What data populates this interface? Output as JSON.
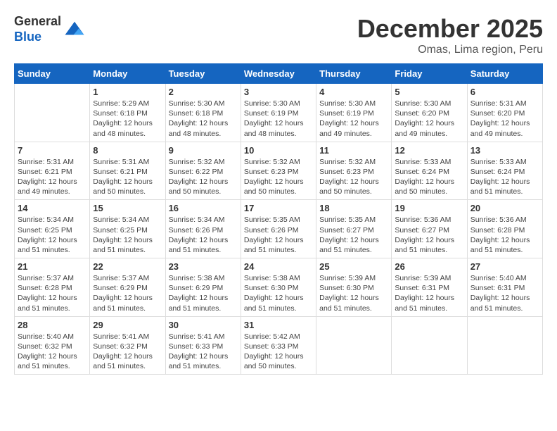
{
  "logo": {
    "line1": "General",
    "line2": "Blue"
  },
  "title": "December 2025",
  "subtitle": "Omas, Lima region, Peru",
  "weekdays": [
    "Sunday",
    "Monday",
    "Tuesday",
    "Wednesday",
    "Thursday",
    "Friday",
    "Saturday"
  ],
  "weeks": [
    [
      {
        "date": "",
        "info": ""
      },
      {
        "date": "1",
        "info": "Sunrise: 5:29 AM\nSunset: 6:18 PM\nDaylight: 12 hours\nand 48 minutes."
      },
      {
        "date": "2",
        "info": "Sunrise: 5:30 AM\nSunset: 6:18 PM\nDaylight: 12 hours\nand 48 minutes."
      },
      {
        "date": "3",
        "info": "Sunrise: 5:30 AM\nSunset: 6:19 PM\nDaylight: 12 hours\nand 48 minutes."
      },
      {
        "date": "4",
        "info": "Sunrise: 5:30 AM\nSunset: 6:19 PM\nDaylight: 12 hours\nand 49 minutes."
      },
      {
        "date": "5",
        "info": "Sunrise: 5:30 AM\nSunset: 6:20 PM\nDaylight: 12 hours\nand 49 minutes."
      },
      {
        "date": "6",
        "info": "Sunrise: 5:31 AM\nSunset: 6:20 PM\nDaylight: 12 hours\nand 49 minutes."
      }
    ],
    [
      {
        "date": "7",
        "info": "Sunrise: 5:31 AM\nSunset: 6:21 PM\nDaylight: 12 hours\nand 49 minutes."
      },
      {
        "date": "8",
        "info": "Sunrise: 5:31 AM\nSunset: 6:21 PM\nDaylight: 12 hours\nand 50 minutes."
      },
      {
        "date": "9",
        "info": "Sunrise: 5:32 AM\nSunset: 6:22 PM\nDaylight: 12 hours\nand 50 minutes."
      },
      {
        "date": "10",
        "info": "Sunrise: 5:32 AM\nSunset: 6:23 PM\nDaylight: 12 hours\nand 50 minutes."
      },
      {
        "date": "11",
        "info": "Sunrise: 5:32 AM\nSunset: 6:23 PM\nDaylight: 12 hours\nand 50 minutes."
      },
      {
        "date": "12",
        "info": "Sunrise: 5:33 AM\nSunset: 6:24 PM\nDaylight: 12 hours\nand 50 minutes."
      },
      {
        "date": "13",
        "info": "Sunrise: 5:33 AM\nSunset: 6:24 PM\nDaylight: 12 hours\nand 51 minutes."
      }
    ],
    [
      {
        "date": "14",
        "info": "Sunrise: 5:34 AM\nSunset: 6:25 PM\nDaylight: 12 hours\nand 51 minutes."
      },
      {
        "date": "15",
        "info": "Sunrise: 5:34 AM\nSunset: 6:25 PM\nDaylight: 12 hours\nand 51 minutes."
      },
      {
        "date": "16",
        "info": "Sunrise: 5:34 AM\nSunset: 6:26 PM\nDaylight: 12 hours\nand 51 minutes."
      },
      {
        "date": "17",
        "info": "Sunrise: 5:35 AM\nSunset: 6:26 PM\nDaylight: 12 hours\nand 51 minutes."
      },
      {
        "date": "18",
        "info": "Sunrise: 5:35 AM\nSunset: 6:27 PM\nDaylight: 12 hours\nand 51 minutes."
      },
      {
        "date": "19",
        "info": "Sunrise: 5:36 AM\nSunset: 6:27 PM\nDaylight: 12 hours\nand 51 minutes."
      },
      {
        "date": "20",
        "info": "Sunrise: 5:36 AM\nSunset: 6:28 PM\nDaylight: 12 hours\nand 51 minutes."
      }
    ],
    [
      {
        "date": "21",
        "info": "Sunrise: 5:37 AM\nSunset: 6:28 PM\nDaylight: 12 hours\nand 51 minutes."
      },
      {
        "date": "22",
        "info": "Sunrise: 5:37 AM\nSunset: 6:29 PM\nDaylight: 12 hours\nand 51 minutes."
      },
      {
        "date": "23",
        "info": "Sunrise: 5:38 AM\nSunset: 6:29 PM\nDaylight: 12 hours\nand 51 minutes."
      },
      {
        "date": "24",
        "info": "Sunrise: 5:38 AM\nSunset: 6:30 PM\nDaylight: 12 hours\nand 51 minutes."
      },
      {
        "date": "25",
        "info": "Sunrise: 5:39 AM\nSunset: 6:30 PM\nDaylight: 12 hours\nand 51 minutes."
      },
      {
        "date": "26",
        "info": "Sunrise: 5:39 AM\nSunset: 6:31 PM\nDaylight: 12 hours\nand 51 minutes."
      },
      {
        "date": "27",
        "info": "Sunrise: 5:40 AM\nSunset: 6:31 PM\nDaylight: 12 hours\nand 51 minutes."
      }
    ],
    [
      {
        "date": "28",
        "info": "Sunrise: 5:40 AM\nSunset: 6:32 PM\nDaylight: 12 hours\nand 51 minutes."
      },
      {
        "date": "29",
        "info": "Sunrise: 5:41 AM\nSunset: 6:32 PM\nDaylight: 12 hours\nand 51 minutes."
      },
      {
        "date": "30",
        "info": "Sunrise: 5:41 AM\nSunset: 6:33 PM\nDaylight: 12 hours\nand 51 minutes."
      },
      {
        "date": "31",
        "info": "Sunrise: 5:42 AM\nSunset: 6:33 PM\nDaylight: 12 hours\nand 50 minutes."
      },
      {
        "date": "",
        "info": ""
      },
      {
        "date": "",
        "info": ""
      },
      {
        "date": "",
        "info": ""
      }
    ]
  ]
}
